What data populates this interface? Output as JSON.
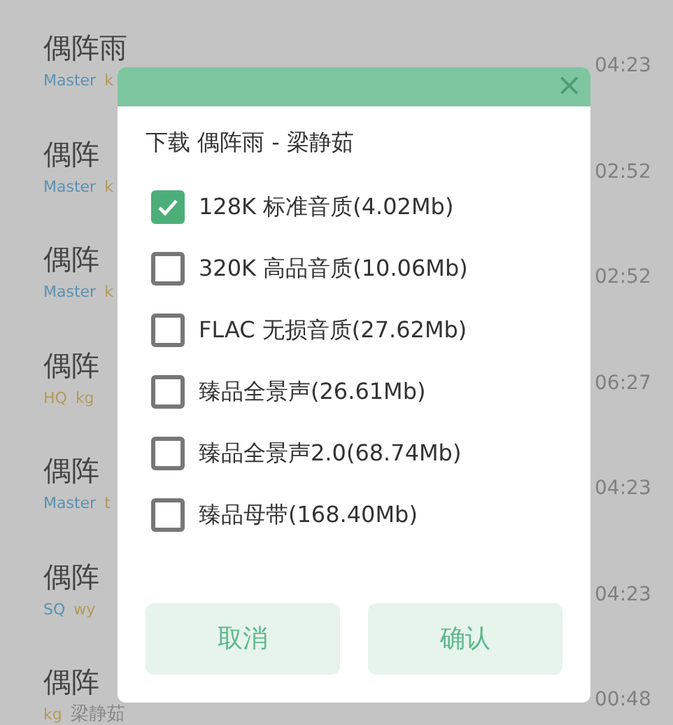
{
  "songs": [
    {
      "title": "偶阵雨",
      "tags": [
        {
          "text": "Master",
          "color": "#5a92b3"
        },
        {
          "text": "k",
          "color": "#b39a5c"
        }
      ],
      "duration": "04:23"
    },
    {
      "title": "偶阵",
      "tags": [
        {
          "text": "Master",
          "color": "#5a92b3"
        },
        {
          "text": "k",
          "color": "#b39a5c"
        }
      ],
      "duration": "02:52"
    },
    {
      "title": "偶阵",
      "tags": [
        {
          "text": "Master",
          "color": "#5a92b3"
        },
        {
          "text": "k",
          "color": "#b39a5c"
        }
      ],
      "duration": "02:52"
    },
    {
      "title": "偶阵",
      "tags": [
        {
          "text": "HQ",
          "color": "#b39a5c"
        },
        {
          "text": "kg",
          "color": "#b39a5c"
        }
      ],
      "duration": "06:27"
    },
    {
      "title": "偶阵",
      "tags": [
        {
          "text": "Master",
          "color": "#5a92b3"
        },
        {
          "text": "t",
          "color": "#b39a5c"
        }
      ],
      "duration": "04:23"
    },
    {
      "title": "偶阵",
      "tags": [
        {
          "text": "SQ",
          "color": "#5a92b3"
        },
        {
          "text": "wy",
          "color": "#b39a5c"
        }
      ],
      "duration": "04:23"
    },
    {
      "title": "偶阵",
      "tags": [
        {
          "text": "kg",
          "color": "#b39a5c"
        }
      ],
      "artist": "梁静茹",
      "duration": "00:48"
    }
  ],
  "dialog": {
    "close": "×",
    "title": "下载 偶阵雨 - 梁静茹",
    "options": [
      {
        "label": "128K 标准音质(4.02Mb)",
        "checked": true
      },
      {
        "label": "320K 高品音质(10.06Mb)",
        "checked": false
      },
      {
        "label": "FLAC 无损音质(27.62Mb)",
        "checked": false
      },
      {
        "label": "臻品全景声(26.61Mb)",
        "checked": false
      },
      {
        "label": "臻品全景声2.0(68.74Mb)",
        "checked": false
      },
      {
        "label": "臻品母带(168.40Mb)",
        "checked": false
      }
    ],
    "buttons": [
      "取消",
      "确认"
    ]
  }
}
